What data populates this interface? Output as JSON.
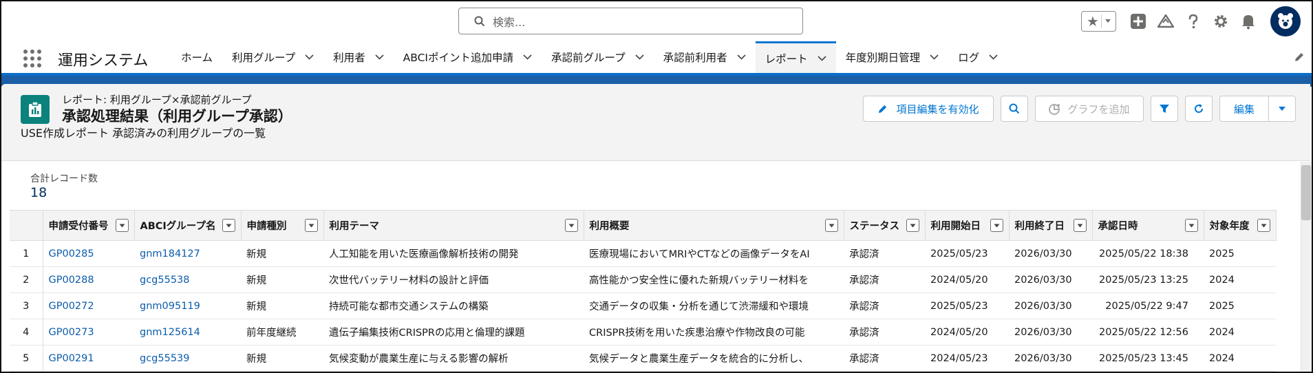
{
  "search": {
    "placeholder": "検索..."
  },
  "app": {
    "name": "運用システム"
  },
  "nav": {
    "items": [
      {
        "label": "ホーム",
        "has_menu": false
      },
      {
        "label": "利用グループ",
        "has_menu": true
      },
      {
        "label": "利用者",
        "has_menu": true
      },
      {
        "label": "ABCIポイント追加申請",
        "has_menu": true
      },
      {
        "label": "承認前グループ",
        "has_menu": true
      },
      {
        "label": "承認前利用者",
        "has_menu": true
      },
      {
        "label": "レポート",
        "has_menu": true,
        "active": true
      },
      {
        "label": "年度別期日管理",
        "has_menu": true
      },
      {
        "label": "ログ",
        "has_menu": true
      }
    ]
  },
  "report": {
    "subtitle": "レポート: 利用グループ×承認前グループ",
    "title": "承認処理結果（利用グループ承認）",
    "description": "USE作成レポート 承認済みの利用グループの一覧",
    "buttons": {
      "enable_field_edit": "項目編集を有効化",
      "add_chart": "グラフを追加",
      "edit": "編集"
    },
    "total_label": "合計レコード数",
    "total_value": "18"
  },
  "table": {
    "columns": [
      "申請受付番号",
      "ABCIグループ名",
      "申請種別",
      "利用テーマ",
      "利用概要",
      "ステータス",
      "利用開始日",
      "利用終了日",
      "承認日時",
      "対象年度"
    ],
    "rows": [
      [
        "1",
        "GP00285",
        "gnm184127",
        "新規",
        "人工知能を用いた医療画像解析技術の開発",
        "医療現場においてMRIやCTなどの画像データをAI",
        "承認済",
        "2025/05/23",
        "2026/03/30",
        "2025/05/22 18:38",
        "2025"
      ],
      [
        "2",
        "GP00288",
        "gcg55538",
        "新規",
        "次世代バッテリー材料の設計と評価",
        "高性能かつ安全性に優れた新規バッテリー材料を",
        "承認済",
        "2024/05/20",
        "2026/03/30",
        "2025/05/23 13:25",
        "2024"
      ],
      [
        "3",
        "GP00272",
        "gnm095119",
        "新規",
        "持続可能な都市交通システムの構築",
        "交通データの収集・分析を通じて渋滞緩和や環境",
        "承認済",
        "2025/05/23",
        "2026/03/30",
        "2025/05/22 9:47",
        "2025"
      ],
      [
        "4",
        "GP00273",
        "gnm125614",
        "前年度継続",
        "遺伝子編集技術CRISPRの応用と倫理的課題",
        "CRISPR技術を用いた疾患治療や作物改良の可能",
        "承認済",
        "2024/05/20",
        "2026/03/30",
        "2025/05/22 12:56",
        "2024"
      ],
      [
        "5",
        "GP00291",
        "gcg55539",
        "新規",
        "気候変動が農業生産に与える影響の解析",
        "気候データと農業生産データを統合的に分析し、",
        "承認済",
        "2024/05/23",
        "2026/03/30",
        "2025/05/23 13:45",
        "2024"
      ]
    ]
  },
  "colors": {
    "brand": "#0176d3",
    "link": "#0b5cab",
    "report_icon": "#0b827c",
    "band": "#1b5fa6"
  }
}
